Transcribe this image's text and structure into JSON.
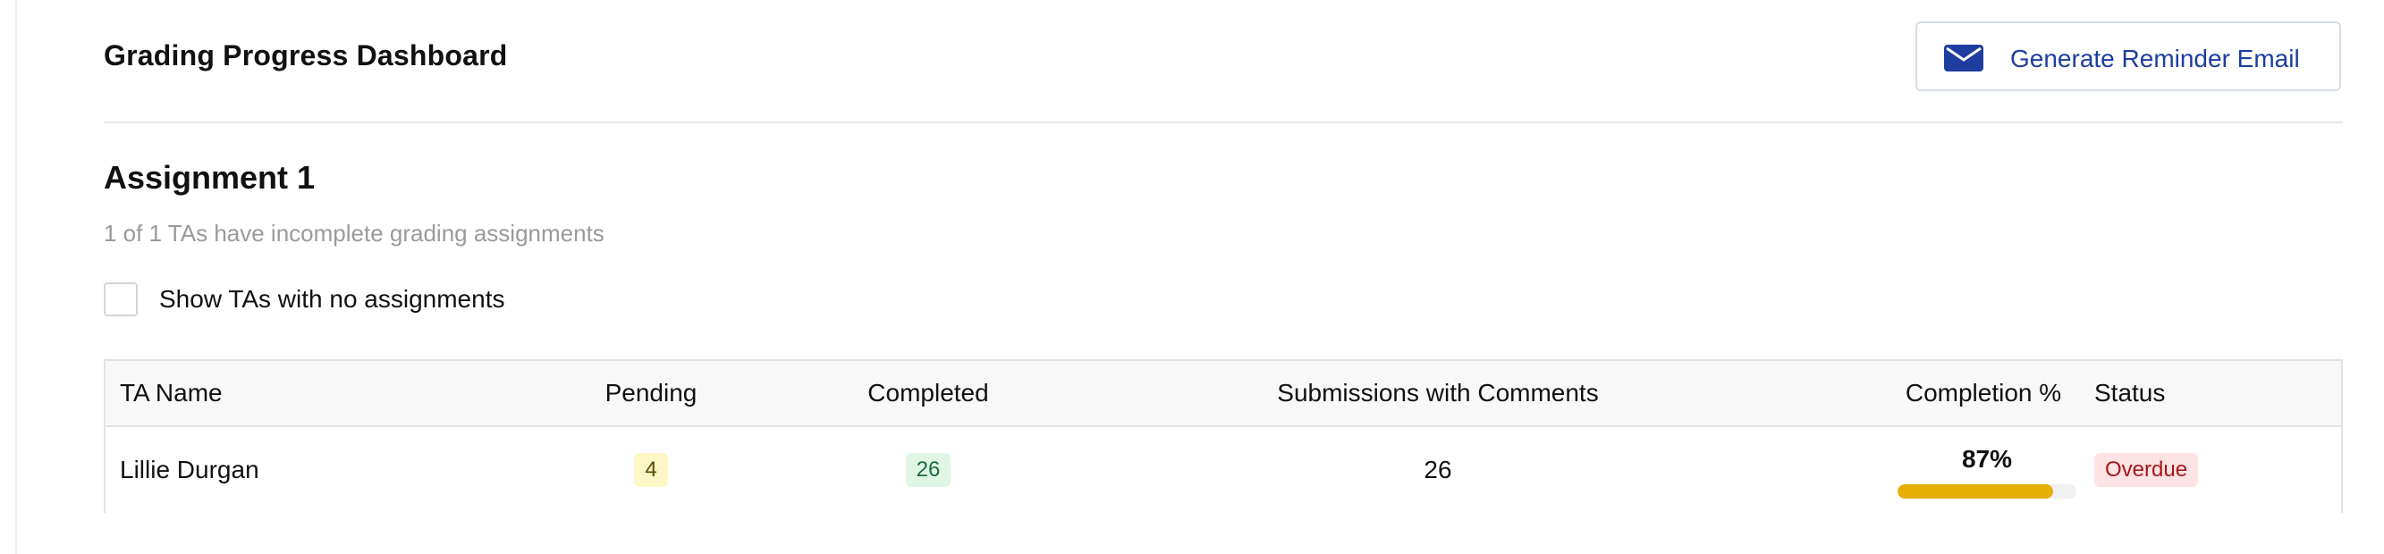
{
  "header": {
    "title": "Grading Progress Dashboard",
    "reminder_button_label": "Generate Reminder Email",
    "reminder_icon": "mail-icon"
  },
  "section": {
    "title": "Assignment 1",
    "subtitle": "1 of 1 TAs have incomplete grading assignments"
  },
  "filters": {
    "show_no_assignments_label": "Show TAs with no assignments",
    "show_no_assignments_checked": false
  },
  "table": {
    "columns": {
      "name": "TA Name",
      "pending": "Pending",
      "completed": "Completed",
      "comments": "Submissions with Comments",
      "completion": "Completion %",
      "status": "Status"
    },
    "rows": [
      {
        "name": "Lillie Durgan",
        "pending": "4",
        "completed": "26",
        "comments": "26",
        "completion_text": "87%",
        "completion_fraction": 0.87,
        "status": "Overdue"
      }
    ]
  },
  "colors": {
    "accent_blue": "#1e3d9f",
    "progress_fill": "#e7ad08",
    "pending_badge_bg": "#fdf6c7",
    "completed_badge_bg": "#dff6e5",
    "overdue_badge_bg": "#fde3e3",
    "overdue_text": "#a3181d"
  }
}
